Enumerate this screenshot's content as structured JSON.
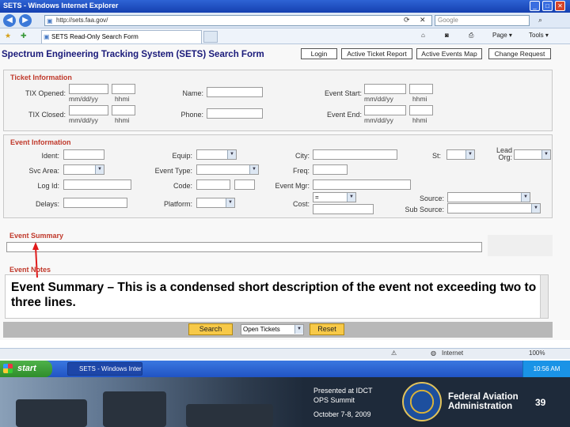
{
  "browser": {
    "window_title": "SETS - Windows Internet Explorer",
    "url": "http://sets.faa.gov/",
    "search_placeholder": "Google",
    "tab_title": "SETS Read-Only Search Form",
    "commands": {
      "page": "Page",
      "tools": "Tools"
    },
    "status": {
      "zone": "Internet",
      "zoom": "100%"
    }
  },
  "app": {
    "title": "Spectrum Engineering Tracking System (SETS) Search Form",
    "buttons": {
      "login": "Login",
      "active_ticket_report": "Active Ticket Report",
      "active_events_map": "Active Events Map",
      "change_request": "Change Request"
    },
    "ticket_information": {
      "heading": "Ticket Information",
      "tix_opened": "TIX Opened:",
      "tix_closed": "TIX Closed:",
      "date_hint": "mm/dd/yy",
      "time_hint": "hhmi",
      "name": "Name:",
      "phone": "Phone:",
      "event_start": "Event Start:",
      "event_end": "Event End:"
    },
    "event_information": {
      "heading": "Event Information",
      "ident": "Ident:",
      "svc_area": "Svc Area:",
      "log_id": "Log Id:",
      "delays": "Delays:",
      "equip": "Equip:",
      "event_type": "Event Type:",
      "code": "Code:",
      "platform": "Platform:",
      "city": "City:",
      "freq": "Freq:",
      "event_mgr": "Event Mgr:",
      "cost": "Cost:",
      "cost_operator": "=",
      "st": "St:",
      "lead_org": "Lead Org:",
      "source": "Source:",
      "sub_source": "Sub Source:"
    },
    "event_summary": {
      "heading": "Event Summary"
    },
    "event_notes": {
      "heading": "Event Notes"
    },
    "callout": "Event Summary – This is a condensed short description of the event not exceeding two to three lines.",
    "bottom": {
      "search": "Search",
      "ticket_filter": "Open Tickets",
      "reset": "Reset"
    }
  },
  "taskbar": {
    "start": "start",
    "item": "SETS - Windows Inter...",
    "clock": "10:56 AM"
  },
  "footer": {
    "presented_line1": "Presented at IDCT",
    "presented_line2": "OPS Summit",
    "date": "October 7-8, 2009",
    "org_line1": "Federal Aviation",
    "org_line2": "Administration",
    "page_number": "39"
  },
  "colors": {
    "section_heading": "#c0392b",
    "app_title": "#1a1a7a",
    "action_button": "#f7c948",
    "arrow": "#e01b1b"
  }
}
